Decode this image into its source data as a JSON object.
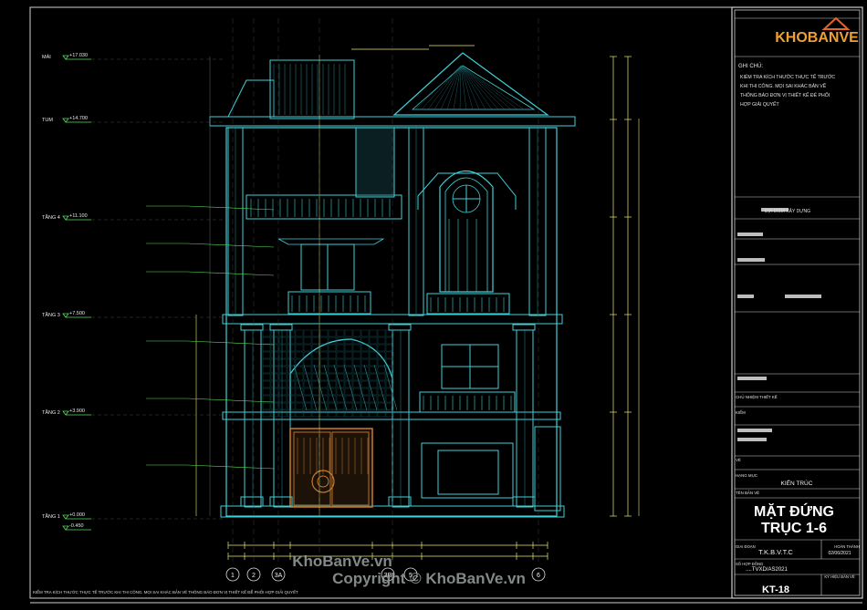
{
  "levels": [
    {
      "name": "MÁI",
      "elev": "+17.030"
    },
    {
      "name": "TUM",
      "elev": "+14.700"
    },
    {
      "name": "TẦNG 4",
      "elev": "+11.100"
    },
    {
      "name": "TẦNG 3",
      "elev": "+7.500"
    },
    {
      "name": "TẦNG 2",
      "elev": "+3.900"
    },
    {
      "name": "TẦNG 1",
      "elev": "+0.000"
    },
    {
      "name": "",
      "elev": "-0.450"
    }
  ],
  "grid_axes": [
    "1",
    "2",
    "3A",
    "3B",
    "5",
    "6"
  ],
  "notes": {
    "heading": "GHI CHÚ:",
    "lines": [
      "KIỂM TRA KÍCH THƯỚC THỰC TẾ TRƯỚC",
      "KHI THI CÔNG. MỌI SAI KHÁC BẢN VẼ",
      "THÔNG BÁO ĐƠN VỊ THIẾT KẾ ĐỂ PHỐI",
      "HỢP GIẢI QUYẾT"
    ]
  },
  "bottom_note": "KIỂM TRA KÍCH THƯỚC THỰC TẾ TRƯỚC KHI THI CÔNG. MỌI SAI KHÁC BẢN VẼ THÔNG BÁO ĐƠN VỊ THIẾT KẾ ĐỂ PHỐI HỢP GIẢI QUYẾT",
  "title_block": {
    "project_label": "ĐỊA ĐIỂM XÂY DỰNG",
    "chu_nhiem": "CHỦ NHIỆM THIẾT KẾ",
    "kiem": "KIỂM",
    "ve": "VẼ",
    "hang_muc_label": "HẠNG MỤC",
    "hang_muc": "KIẾN TRÚC",
    "ten_ban_ve_label": "TÊN BẢN VẼ",
    "title_line1": "MẶT ĐỨNG",
    "title_line2": "TRỤC 1-6",
    "giai_doan_label": "GIAI ĐOẠN",
    "giai_doan": "T.K.B.V.T.C",
    "hoan_thanh_label": "HOÀN THÀNH",
    "hoan_thanh": "02/06/2021",
    "so_hop_dong_label": "SỐ HỢP ĐỒNG",
    "so_hop_dong": "....TVXD/AS2021",
    "ky_hieu_label": "KÝ HIỆU BẢN VẼ",
    "sheet": "KT-18"
  },
  "logo": {
    "text": "KHOBANVE"
  },
  "watermark": {
    "line1": "KhoBanVe.vn",
    "line2": "Copyright © KhoBanVe.vn"
  },
  "colors": {
    "frame": "#cfcfcf",
    "facade": "#3fd0d8",
    "dim": "#e8e870",
    "door": "#c77a2c",
    "label": "#58e05a"
  }
}
